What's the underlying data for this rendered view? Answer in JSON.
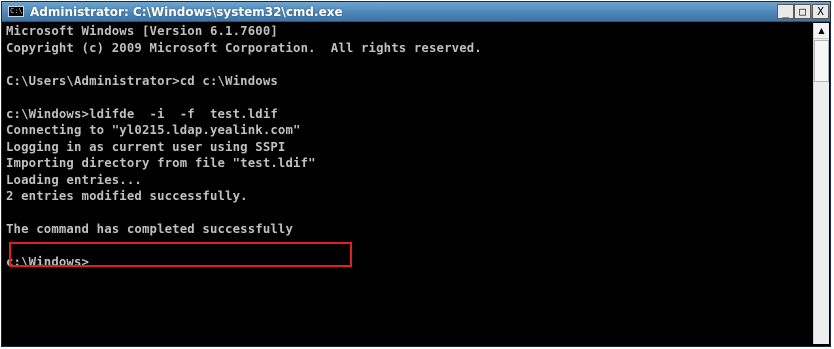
{
  "window": {
    "title": "Administrator: C:\\Windows\\system32\\cmd.exe",
    "icon": "cmd-console-icon",
    "icon_text": "C:\\",
    "controls": {
      "minimize": "_",
      "maximize": "□",
      "close": "X"
    }
  },
  "console": {
    "lines": [
      "Microsoft Windows [Version 6.1.7600]",
      "Copyright (c) 2009 Microsoft Corporation.  All rights reserved.",
      "",
      "C:\\Users\\Administrator>cd c:\\Windows",
      "",
      "c:\\Windows>ldifde  -i  -f  test.ldif",
      "Connecting to \"yl0215.ldap.yealink.com\"",
      "Logging in as current user using SSPI",
      "Importing directory from file \"test.ldif\"",
      "Loading entries...",
      "2 entries modified successfully.",
      "",
      "The command has completed successfully",
      "",
      "c:\\Windows>"
    ],
    "highlighted_line_index": 10
  },
  "colors": {
    "console_bg": "#000000",
    "console_text": "#c0c0c0",
    "titlebar": "#4f88b8",
    "highlight_border": "#e02020"
  },
  "scrollbar": {
    "up_arrow": "▲"
  }
}
